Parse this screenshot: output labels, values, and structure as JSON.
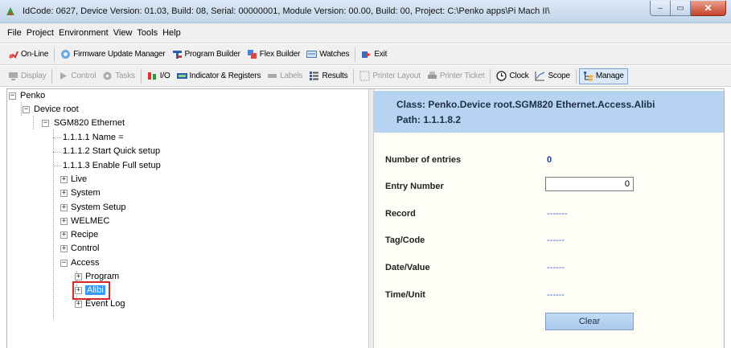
{
  "window": {
    "title": "IdCode: 0627, Device Version: 01.03, Build: 08, Serial: 00000001, Module Version: 00.00, Build: 00, Project: C:\\Penko apps\\Pi Mach II\\",
    "min_glyph": "–",
    "max_glyph": "▭",
    "close_glyph": "✕"
  },
  "menu": [
    "File",
    "Project",
    "Environment",
    "View",
    "Tools",
    "Help"
  ],
  "toolbar1": [
    {
      "label": "On-Line",
      "icon": "plug-icon"
    },
    {
      "label": "Firmware Update Manager",
      "icon": "firmware-icon"
    },
    {
      "label": "Program Builder",
      "icon": "program-builder-icon"
    },
    {
      "label": "Flex Builder",
      "icon": "flex-builder-icon"
    },
    {
      "label": "Watches",
      "icon": "watches-icon"
    },
    {
      "label": "Exit",
      "icon": "exit-icon"
    }
  ],
  "toolbar2": [
    {
      "label": "Display",
      "icon": "display-icon",
      "disabled": true
    },
    {
      "label": "Control",
      "icon": "control-icon",
      "disabled": true
    },
    {
      "label": "Tasks",
      "icon": "tasks-icon",
      "disabled": true
    },
    {
      "label": "I/O",
      "icon": "io-icon",
      "disabled": false
    },
    {
      "label": "Indicator & Registers",
      "icon": "indicator-icon",
      "disabled": false
    },
    {
      "label": "Labels",
      "icon": "labels-icon",
      "disabled": true
    },
    {
      "label": "Results",
      "icon": "results-icon",
      "disabled": false
    },
    {
      "label": "Printer Layout",
      "icon": "printer-layout-icon",
      "disabled": true
    },
    {
      "label": "Printer Ticket",
      "icon": "printer-ticket-icon",
      "disabled": true
    },
    {
      "label": "Clock",
      "icon": "clock-icon",
      "disabled": false
    },
    {
      "label": "Scope",
      "icon": "scope-icon",
      "disabled": false
    },
    {
      "label": "Manage",
      "icon": "manage-icon",
      "disabled": false,
      "pressed": true
    }
  ],
  "tree": [
    {
      "label": "Penko",
      "exp": "−"
    },
    {
      "label": "Device root",
      "exp": "−"
    },
    {
      "label": "SGM820 Ethernet",
      "exp": "−"
    },
    {
      "label": "1.1.1.1 Name =",
      "exp": ""
    },
    {
      "label": "1.1.1.2 Start Quick setup",
      "exp": ""
    },
    {
      "label": "1.1.1.3 Enable Full setup",
      "exp": ""
    },
    {
      "label": "Live",
      "exp": "+"
    },
    {
      "label": "System",
      "exp": "+"
    },
    {
      "label": "System Setup",
      "exp": "+"
    },
    {
      "label": "WELMEC",
      "exp": "+"
    },
    {
      "label": "Recipe",
      "exp": "+"
    },
    {
      "label": "Control",
      "exp": "+"
    },
    {
      "label": "Access",
      "exp": "−"
    },
    {
      "label": "Program",
      "exp": "+"
    },
    {
      "label": "Alibi",
      "exp": "+",
      "selected": true
    },
    {
      "label": "Event Log",
      "exp": "+"
    }
  ],
  "detail": {
    "class_text": "Class:  Penko.Device root.SGM820 Ethernet.Access.Alibi",
    "path_text": "Path:  1.1.1.8.2",
    "fields": {
      "num_entries": {
        "label": "Number of entries",
        "value": "0"
      },
      "entry_number": {
        "label": "Entry Number",
        "value": "0"
      },
      "record": {
        "label": "Record",
        "value": "-------"
      },
      "tag_code": {
        "label": "Tag/Code",
        "value": "------"
      },
      "date_value": {
        "label": "Date/Value",
        "value": "------"
      },
      "time_unit": {
        "label": "Time/Unit",
        "value": "------"
      }
    },
    "clear_label": "Clear"
  },
  "colors": {
    "selection": "#3399ff",
    "header": "#b6d3f2",
    "highlight": "#d8262b"
  }
}
